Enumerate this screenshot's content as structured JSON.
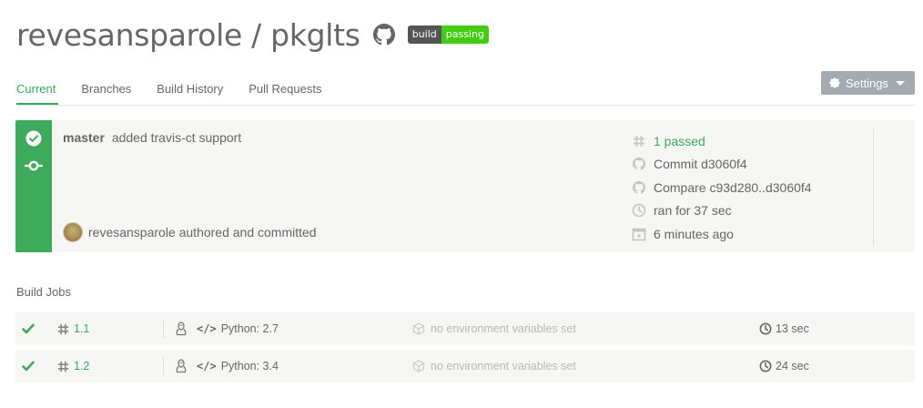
{
  "repo": {
    "title": "revesansparole / pkglts",
    "badge_left": "build",
    "badge_right": "passing",
    "badge_colors": {
      "left": "#555555",
      "right": "#44cc11"
    }
  },
  "tabs": [
    {
      "label": "Current",
      "active": true
    },
    {
      "label": "Branches",
      "active": false
    },
    {
      "label": "Build History",
      "active": false
    },
    {
      "label": "Pull Requests",
      "active": false
    }
  ],
  "settings": {
    "label": "Settings"
  },
  "build": {
    "status": "passed",
    "status_color": "#3eaa5b",
    "branch": "master",
    "message": "added travis-ct support",
    "author_line": "revesansparole authored and committed",
    "meta": {
      "build_number": "1 passed",
      "commit": "Commit d3060f4",
      "compare": "Compare c93d280..d3060f4",
      "duration": "ran for 37 sec",
      "finished": "6 minutes ago"
    }
  },
  "jobs": {
    "title": "Build Jobs",
    "rows": [
      {
        "number": "1.1",
        "language": "Python: 2.7",
        "env": "no environment variables set",
        "duration": "13 sec"
      },
      {
        "number": "1.2",
        "language": "Python: 3.4",
        "env": "no environment variables set",
        "duration": "24 sec"
      }
    ]
  },
  "icons": {
    "github": "github-octocat-icon",
    "gear": "gear-icon",
    "check": "check-circle-icon",
    "commit": "commit-node-icon",
    "hash": "hash-icon",
    "git": "git-icon",
    "clock": "clock-icon",
    "calendar": "calendar-icon",
    "linux": "linux-tux-icon",
    "code": "code-icon",
    "cube": "cube-icon"
  },
  "colors": {
    "accent": "#39a85b",
    "card_bg": "#f6f6f4",
    "settings_bg": "#a3aab0"
  }
}
